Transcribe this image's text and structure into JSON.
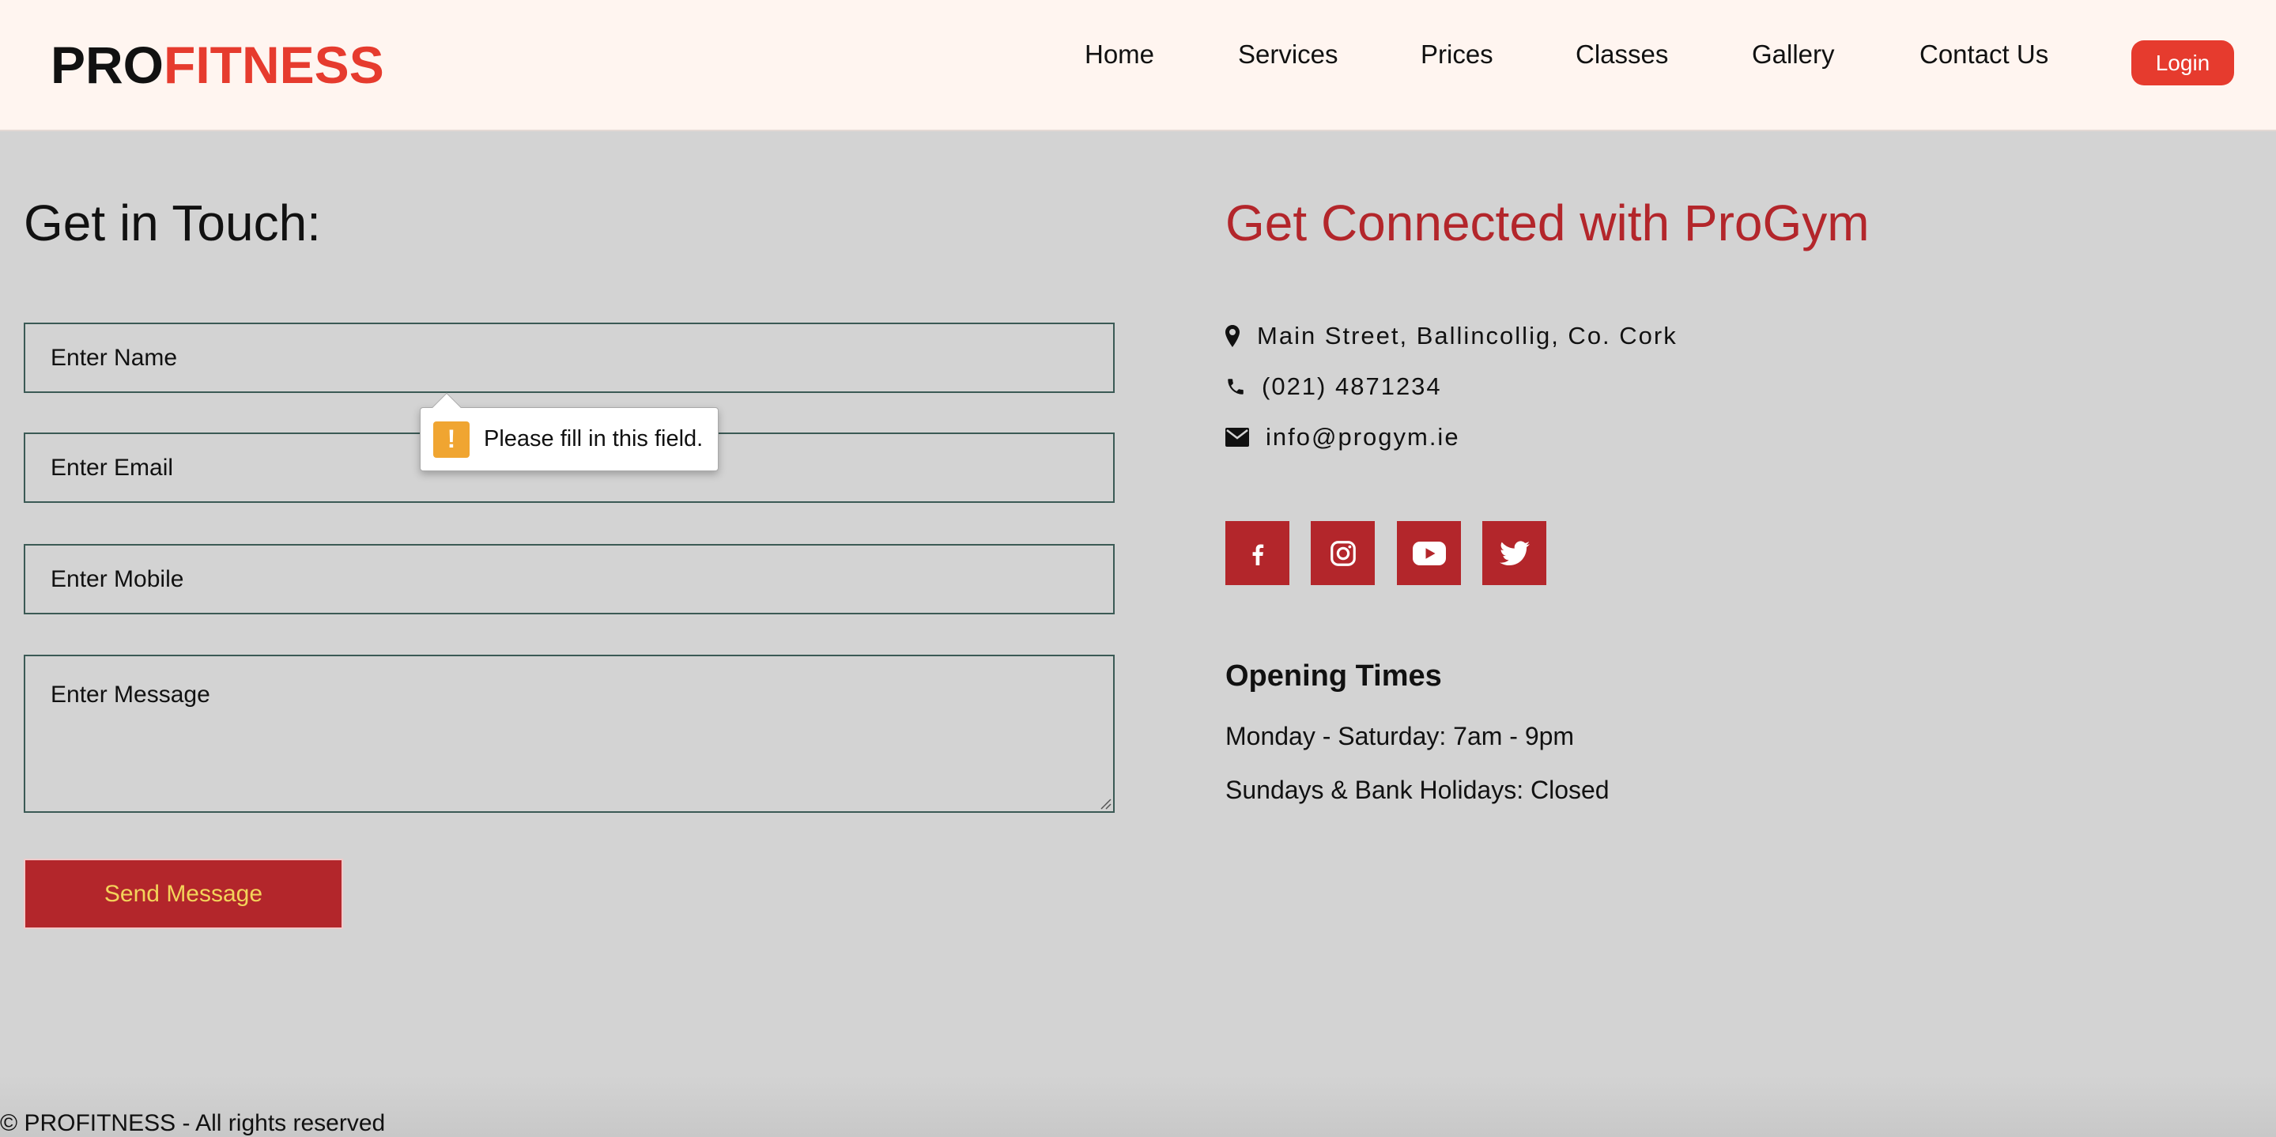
{
  "header": {
    "logo_part1": "PRO",
    "logo_part2": "FITNESS",
    "nav": [
      "Home",
      "Services",
      "Prices",
      "Classes",
      "Gallery",
      "Contact Us"
    ],
    "login_label": "Login"
  },
  "form": {
    "title": "Get in Touch:",
    "name_placeholder": "Enter Name",
    "email_placeholder": "Enter Email",
    "mobile_placeholder": "Enter Mobile",
    "message_placeholder": "Enter Message",
    "send_label": "Send Message",
    "validation_message": "Please fill in this field."
  },
  "contact": {
    "title": "Get Connected with ProGym",
    "address": "Main Street, Ballincollig, Co. Cork",
    "phone": "(021) 4871234",
    "email": "info@progym.ie",
    "socials": [
      "facebook-icon",
      "instagram-icon",
      "youtube-icon",
      "twitter-icon"
    ]
  },
  "opening": {
    "title": "Opening Times",
    "weekdays": "Monday - Saturday: 7am - 9pm",
    "weekends": "Sundays & Bank Holidays: Closed"
  },
  "footer": {
    "text": "© PROFITNESS - All rights reserved"
  },
  "colors": {
    "brand_red": "#e63b2e",
    "accent_red": "#b3262b",
    "button_text": "#f3d35a",
    "header_bg": "#fff5f0",
    "page_bg": "#d3d3d3"
  }
}
